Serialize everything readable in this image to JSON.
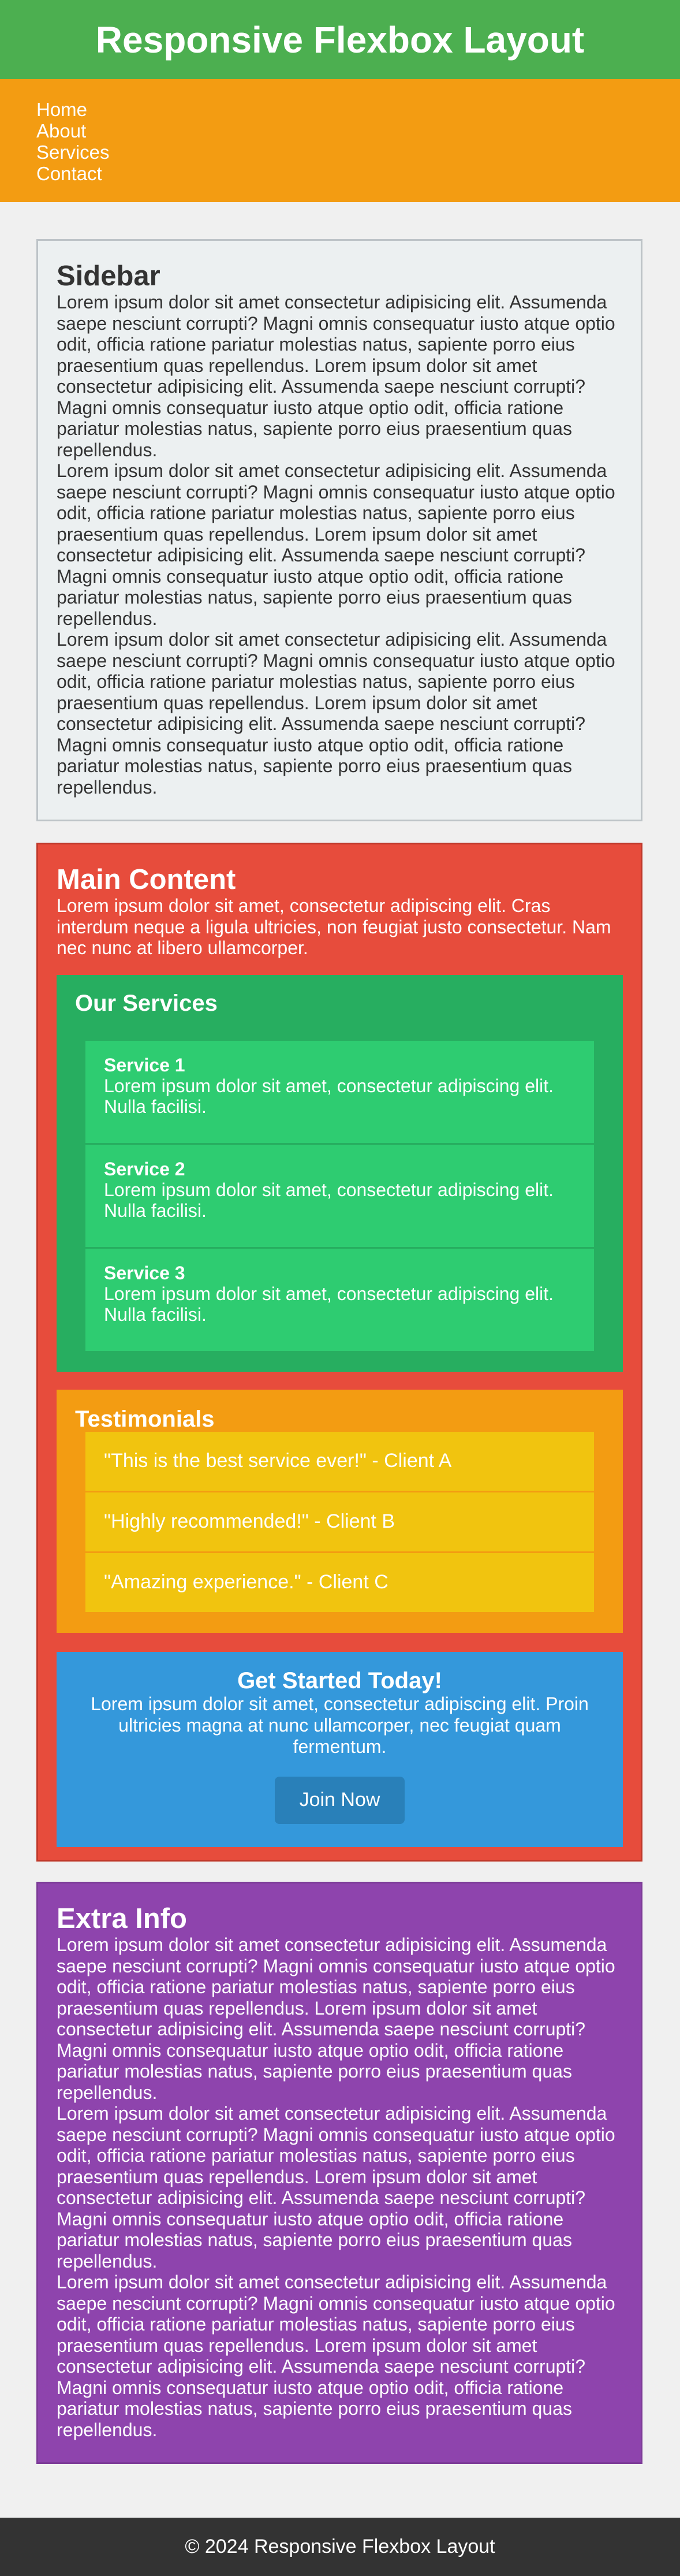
{
  "header": {
    "title": "Responsive Flexbox Layout"
  },
  "nav": {
    "items": [
      "Home",
      "About",
      "Services",
      "Contact"
    ]
  },
  "sidebar": {
    "title": "Sidebar",
    "paragraphs": [
      "Lorem ipsum dolor sit amet consectetur adipisicing elit. Assumenda saepe nesciunt corrupti? Magni omnis consequatur iusto atque optio odit, officia ratione pariatur molestias natus, sapiente porro eius praesentium quas repellendus. Lorem ipsum dolor sit amet consectetur adipisicing elit. Assumenda saepe nesciunt corrupti? Magni omnis consequatur iusto atque optio odit, officia ratione pariatur molestias natus, sapiente porro eius praesentium quas repellendus.",
      "Lorem ipsum dolor sit amet consectetur adipisicing elit. Assumenda saepe nesciunt corrupti? Magni omnis consequatur iusto atque optio odit, officia ratione pariatur molestias natus, sapiente porro eius praesentium quas repellendus. Lorem ipsum dolor sit amet consectetur adipisicing elit. Assumenda saepe nesciunt corrupti? Magni omnis consequatur iusto atque optio odit, officia ratione pariatur molestias natus, sapiente porro eius praesentium quas repellendus.",
      "Lorem ipsum dolor sit amet consectetur adipisicing elit. Assumenda saepe nesciunt corrupti? Magni omnis consequatur iusto atque optio odit, officia ratione pariatur molestias natus, sapiente porro eius praesentium quas repellendus. Lorem ipsum dolor sit amet consectetur adipisicing elit. Assumenda saepe nesciunt corrupti? Magni omnis consequatur iusto atque optio odit, officia ratione pariatur molestias natus, sapiente porro eius praesentium quas repellendus."
    ]
  },
  "main": {
    "title": "Main Content",
    "lead": "Lorem ipsum dolor sit amet, consectetur adipiscing elit. Cras interdum neque a ligula ultricies, non feugiat justo consectetur. Nam nec nunc at libero ullamcorper.",
    "services": {
      "title": "Our Services",
      "items": [
        {
          "title": "Service 1",
          "text": "Lorem ipsum dolor sit amet, consectetur adipiscing elit. Nulla facilisi."
        },
        {
          "title": "Service 2",
          "text": "Lorem ipsum dolor sit amet, consectetur adipiscing elit. Nulla facilisi."
        },
        {
          "title": "Service 3",
          "text": "Lorem ipsum dolor sit amet, consectetur adipiscing elit. Nulla facilisi."
        }
      ]
    },
    "testimonials": {
      "title": "Testimonials",
      "items": [
        "\"This is the best service ever!\" - Client A",
        "\"Highly recommended!\" - Client B",
        "\"Amazing experience.\" - Client C"
      ]
    },
    "cta": {
      "title": "Get Started Today!",
      "text": "Lorem ipsum dolor sit amet, consectetur adipiscing elit. Proin ultricies magna at nunc ullamcorper, nec feugiat quam fermentum.",
      "button_label": "Join Now"
    }
  },
  "extra": {
    "title": "Extra Info",
    "paragraphs": [
      "Lorem ipsum dolor sit amet consectetur adipisicing elit. Assumenda saepe nesciunt corrupti? Magni omnis consequatur iusto atque optio odit, officia ratione pariatur molestias natus, sapiente porro eius praesentium quas repellendus. Lorem ipsum dolor sit amet consectetur adipisicing elit. Assumenda saepe nesciunt corrupti? Magni omnis consequatur iusto atque optio odit, officia ratione pariatur molestias natus, sapiente porro eius praesentium quas repellendus.",
      "Lorem ipsum dolor sit amet consectetur adipisicing elit. Assumenda saepe nesciunt corrupti? Magni omnis consequatur iusto atque optio odit, officia ratione pariatur molestias natus, sapiente porro eius praesentium quas repellendus. Lorem ipsum dolor sit amet consectetur adipisicing elit. Assumenda saepe nesciunt corrupti? Magni omnis consequatur iusto atque optio odit, officia ratione pariatur molestias natus, sapiente porro eius praesentium quas repellendus.",
      "Lorem ipsum dolor sit amet consectetur adipisicing elit. Assumenda saepe nesciunt corrupti? Magni omnis consequatur iusto atque optio odit, officia ratione pariatur molestias natus, sapiente porro eius praesentium quas repellendus. Lorem ipsum dolor sit amet consectetur adipisicing elit. Assumenda saepe nesciunt corrupti? Magni omnis consequatur iusto atque optio odit, officia ratione pariatur molestias natus, sapiente porro eius praesentium quas repellendus."
    ]
  },
  "footer": {
    "text": "© 2024 Responsive Flexbox Layout"
  }
}
